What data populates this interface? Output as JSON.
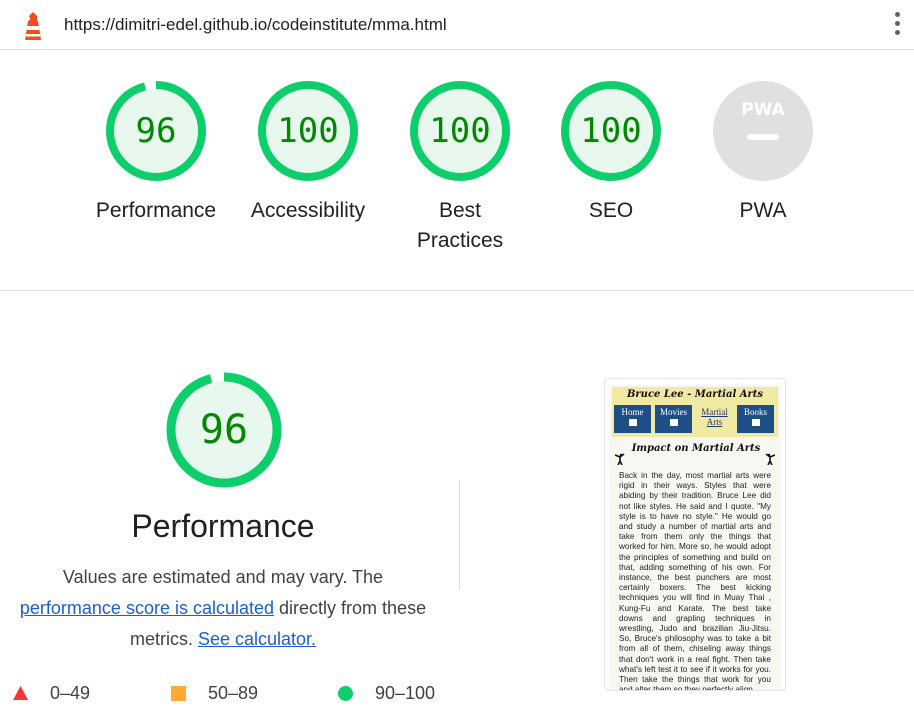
{
  "browser": {
    "url": "https://dimitri-edel.github.io/codeinstitute/mma.html"
  },
  "gauges": [
    {
      "label": "Performance",
      "score": "96",
      "fraction": 0.96
    },
    {
      "label": "Accessibility",
      "score": "100",
      "fraction": 1.0
    },
    {
      "label": "Best Practices",
      "line1": "Best",
      "line2": "Practices",
      "score": "100",
      "fraction": 1.0
    },
    {
      "label": "SEO",
      "score": "100",
      "fraction": 1.0
    },
    {
      "label": "PWA",
      "score": "",
      "fraction": 0
    }
  ],
  "performance": {
    "score": "96",
    "fraction": 0.96,
    "title": "Performance",
    "desc_part1": "Values are estimated and may vary. The",
    "link1": "performance score is calculated",
    "desc_part2": "directly from these",
    "desc_part3": "metrics.",
    "link2": "See calculator."
  },
  "legend": [
    {
      "range": "0–49",
      "color": "#ff3333",
      "shape": "triangle"
    },
    {
      "range": "50–89",
      "color": "#ffaa33",
      "shape": "square"
    },
    {
      "range": "90–100",
      "color": "#0cce6b",
      "shape": "circle"
    }
  ],
  "thumbnail": {
    "site_title": "Bruce Lee - Martial Arts",
    "nav": [
      {
        "line1": "Home",
        "line2": ""
      },
      {
        "line1": "Movies",
        "line2": ""
      },
      {
        "line1": "Martial",
        "line2": "Arts"
      },
      {
        "line1": "Books",
        "line2": ""
      }
    ],
    "section_title": "Impact on Martial Arts",
    "body": "Back in the day, most martial arts were rigid in their ways. Styles that were abiding by their tradition. Bruce Lee did not like styles. He said and I quote. \"My style is to have no style.\" He would go and study a number of martial arts and take from them only the things that worked for him. More so, he would adopt the principles of something and build on that, adding something of his own. For instance, the best punchers are most certainly boxers. The best kicking techniques you will find in Muay Thai , Kung-Fu and Karate. The best take downs and grapling techniques in wrestling, Judo and brazilian Jiu-Jitsu. So, Bruce's philosophy was to take a bit from all of them, chiseling away things that don't work in a real fight. Then take what's left test it to see if it works for you. Then take the things that work for you and alter them so they perfectly align"
  },
  "colors": {
    "pass": "#0cce6b",
    "pass_text": "#008800",
    "pass_fill": "#e8f8ee",
    "pwa_gray": "#e0e0e0",
    "link": "#1a5fd0"
  }
}
